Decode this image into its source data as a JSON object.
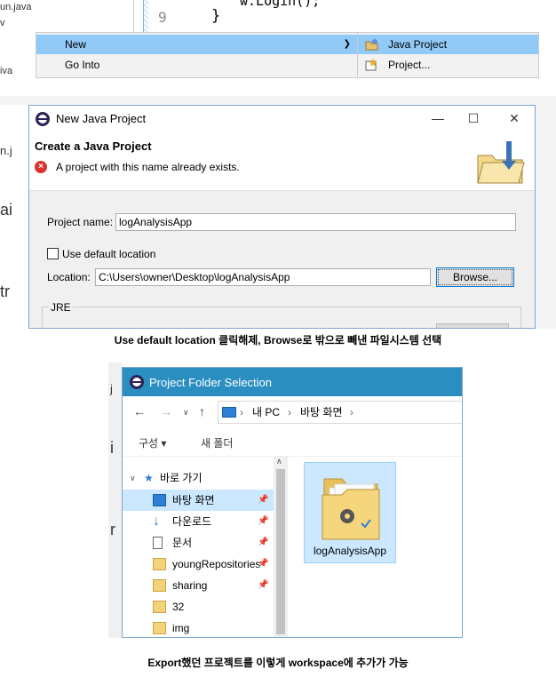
{
  "editor": {
    "left_lines": [
      "un.java",
      "v",
      "iva"
    ],
    "line_number": "9",
    "code_brace": "}",
    "code_fragment": "w.Login();"
  },
  "context_menu": {
    "items": [
      {
        "label": "New",
        "has_submenu": true,
        "highlighted": true
      },
      {
        "label": "Go Into",
        "has_submenu": false,
        "highlighted": false
      }
    ],
    "submenu": [
      {
        "label": "Java Project",
        "icon": "java-project-icon",
        "highlighted": true
      },
      {
        "label": "Project...",
        "icon": "project-icon",
        "highlighted": false
      }
    ]
  },
  "new_project_dialog": {
    "left_fragments": [
      "n.j",
      "ai",
      "tr"
    ],
    "title": "New Java Project",
    "heading": "Create a Java Project",
    "error_message": "A project with this name already exists.",
    "project_name_label": "Project name:",
    "project_name_value": "logAnalysisApp",
    "use_default_label": "Use default location",
    "use_default_checked": false,
    "location_label": "Location:",
    "location_value": "C:\\Users\\owner\\Desktop\\logAnalysisApp",
    "browse_label": "Browse...",
    "jre_group_label": "JRE"
  },
  "caption1": "Use default location 클릭해제, Browse로 밖으로 빼낸 파일시스템 선택",
  "folder_dialog": {
    "left_fragments": [
      "j",
      "i",
      "r"
    ],
    "title": "Project Folder Selection",
    "address": [
      "내 PC",
      "바탕 화면"
    ],
    "organize_label": "구성 ▾",
    "new_folder_label": "새 폴더",
    "quick_access_label": "바로 가기",
    "nav_items": [
      {
        "label": "바탕 화면",
        "icon": "desktop-icon",
        "pinned": true,
        "selected": true
      },
      {
        "label": "다운로드",
        "icon": "download-icon",
        "pinned": true,
        "selected": false
      },
      {
        "label": "문서",
        "icon": "document-icon",
        "pinned": true,
        "selected": false
      },
      {
        "label": "youngRepositories",
        "icon": "folder-icon",
        "pinned": true,
        "selected": false
      },
      {
        "label": "sharing",
        "icon": "shared-folder-icon",
        "pinned": true,
        "selected": false
      },
      {
        "label": "32",
        "icon": "folder-icon",
        "pinned": false,
        "selected": false
      },
      {
        "label": "img",
        "icon": "folder-icon",
        "pinned": false,
        "selected": false
      }
    ],
    "content_item": "logAnalysisApp"
  },
  "caption2": "Export했던 프로젝트를 이렇게 workspace에 추가가 가능",
  "colors": {
    "menu_highlight": "#91c9f7",
    "title_blue": "#2b8ec0",
    "selection": "#cce8ff",
    "error_red": "#d9342b"
  }
}
